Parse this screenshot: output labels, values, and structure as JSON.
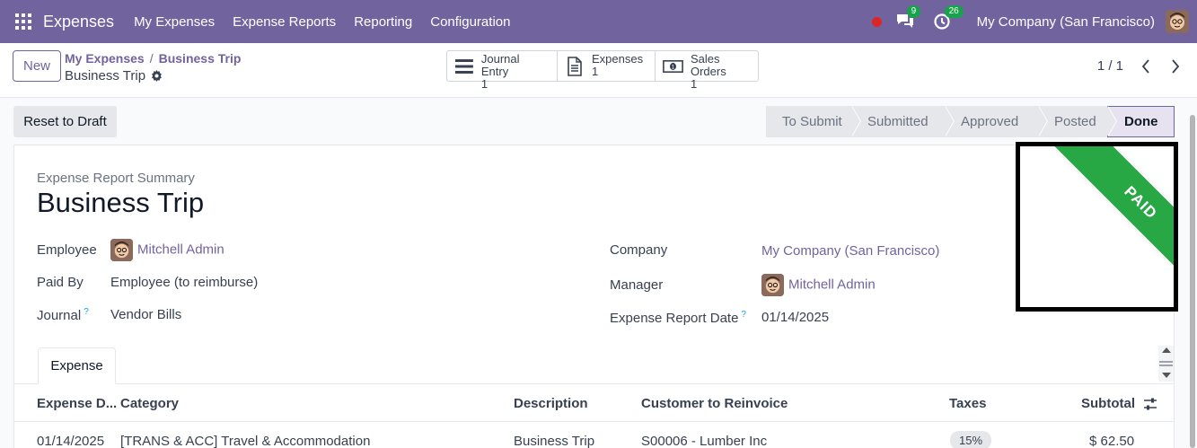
{
  "nav": {
    "app_name": "Expenses",
    "menu": [
      "My Expenses",
      "Expense Reports",
      "Reporting",
      "Configuration"
    ],
    "messages_count": "9",
    "activities_count": "26",
    "company": "My Company (San Francisco)"
  },
  "control": {
    "new_label": "New",
    "breadcrumb": [
      "My Expenses",
      "Business Trip"
    ],
    "record_name": "Business Trip",
    "smart_buttons": [
      {
        "label": "Journal Entry",
        "count": "1"
      },
      {
        "label": "Expenses",
        "count": "1"
      },
      {
        "label": "Sales Orders",
        "count": "1"
      }
    ],
    "pager": "1 / 1"
  },
  "actions": {
    "reset_label": "Reset to Draft"
  },
  "stages": [
    "To Submit",
    "Submitted",
    "Approved",
    "Posted",
    "Done"
  ],
  "active_stage": "Done",
  "sheet": {
    "summary_label": "Expense Report Summary",
    "title": "Business Trip",
    "ribbon": "PAID",
    "fields": {
      "employee_label": "Employee",
      "employee_value": "Mitchell Admin",
      "paid_by_label": "Paid By",
      "paid_by_value": "Employee (to reimburse)",
      "journal_label": "Journal",
      "journal_value": "Vendor Bills",
      "company_label": "Company",
      "company_value": "My Company (San Francisco)",
      "manager_label": "Manager",
      "manager_value": "Mitchell Admin",
      "date_label": "Expense Report Date",
      "date_value": "01/14/2025"
    },
    "help_mark": "?",
    "tab_label": "Expense",
    "table": {
      "headers": [
        "Expense D...",
        "Category",
        "Description",
        "Customer to Reinvoice",
        "Taxes",
        "Subtotal"
      ],
      "rows": [
        {
          "date": "01/14/2025",
          "category": "[TRANS & ACC] Travel & Accommodation",
          "description": "Business Trip",
          "customer": "S00006 - Lumber Inc",
          "tax": "15%",
          "subtotal": "$ 62.50"
        }
      ]
    }
  },
  "colors": {
    "brand": "#71639e",
    "ribbon": "#28a745",
    "badge": "#17a34a"
  }
}
